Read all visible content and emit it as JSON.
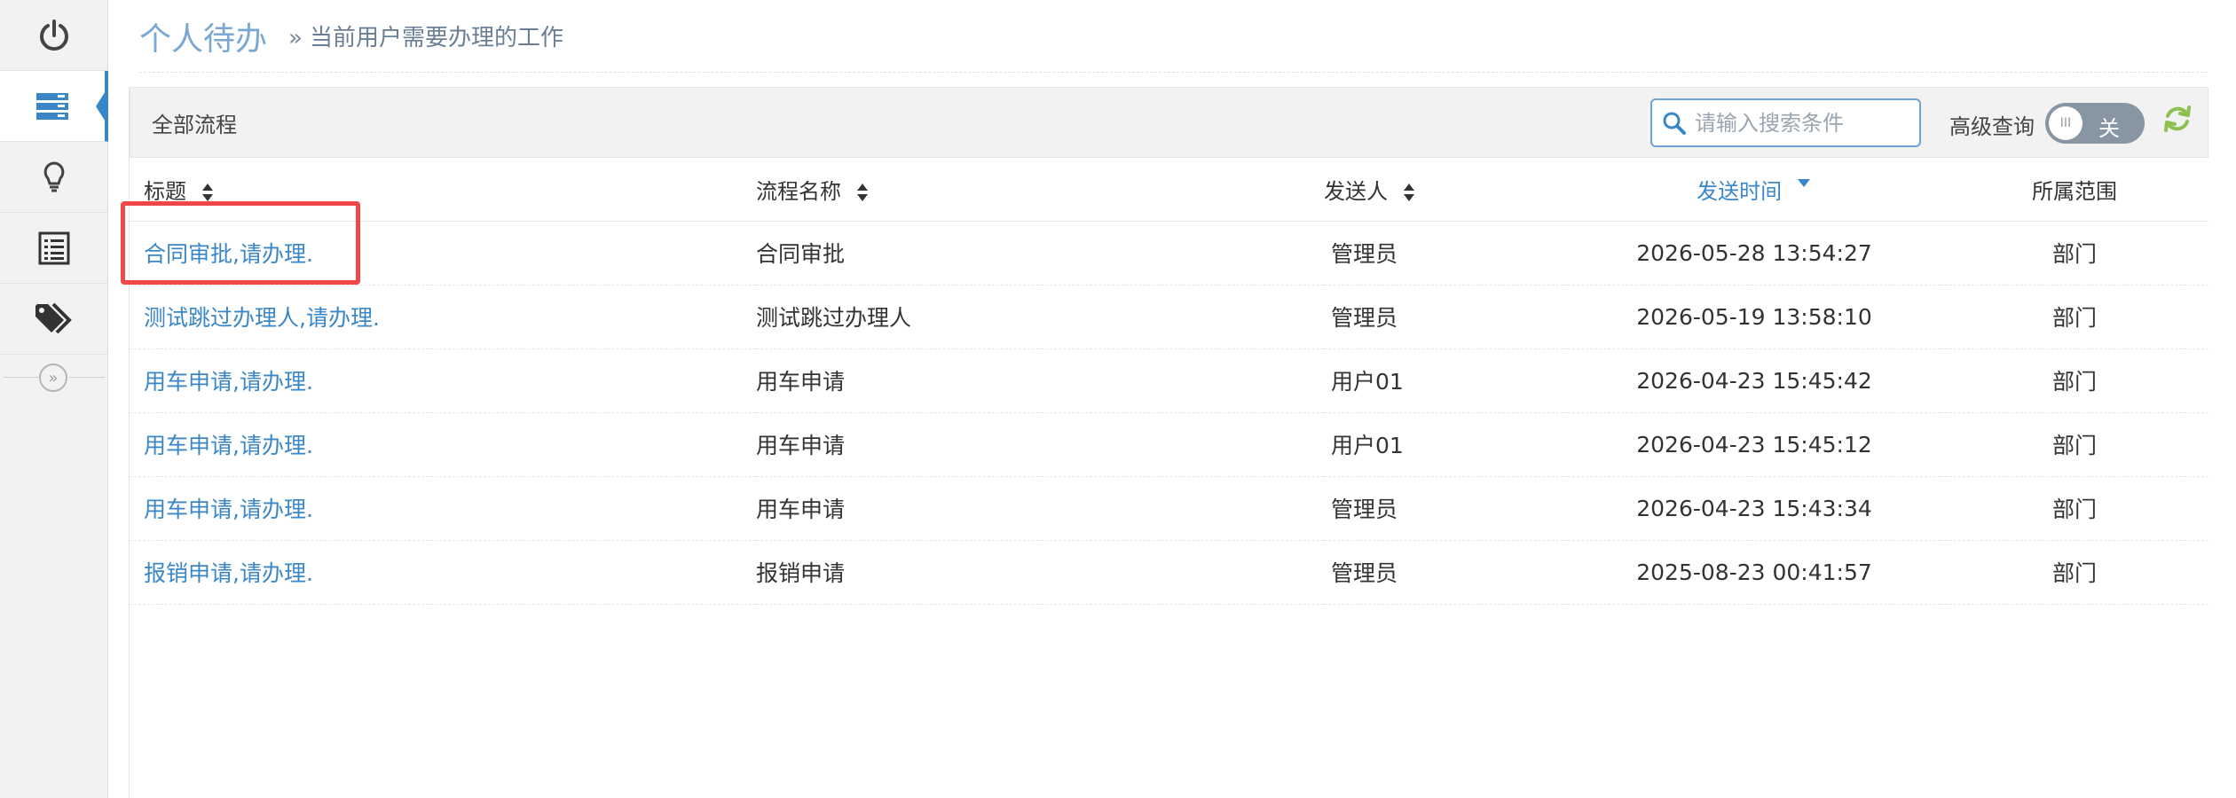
{
  "header": {
    "title": "个人待办",
    "subtitle_chevron": "»",
    "subtitle": "当前用户需要办理的工作"
  },
  "sidebar": {
    "items": [
      {
        "icon": "power-icon"
      },
      {
        "icon": "list-icon",
        "active": true
      },
      {
        "icon": "lightbulb-icon"
      },
      {
        "icon": "document-list-icon"
      },
      {
        "icon": "tags-icon"
      }
    ],
    "collapse_glyph": "»"
  },
  "toolbar": {
    "label": "全部流程",
    "search_placeholder": "请输入搜索条件",
    "advanced_label": "高级查询",
    "toggle_knob": "III",
    "toggle_state": "关"
  },
  "table": {
    "columns": [
      "标题",
      "流程名称",
      "发送人",
      "发送时间",
      "所属范围"
    ],
    "sorted_column": "发送时间",
    "rows": [
      {
        "title": "合同审批,请办理.",
        "flow": "合同审批",
        "sender": "管理员",
        "time": "2026-05-28 13:54:27",
        "scope": "部门"
      },
      {
        "title": "测试跳过办理人,请办理.",
        "flow": "测试跳过办理人",
        "sender": "管理员",
        "time": "2026-05-19 13:58:10",
        "scope": "部门"
      },
      {
        "title": "用车申请,请办理.",
        "flow": "用车申请",
        "sender": "用户01",
        "time": "2026-04-23 15:45:42",
        "scope": "部门"
      },
      {
        "title": "用车申请,请办理.",
        "flow": "用车申请",
        "sender": "用户01",
        "time": "2026-04-23 15:45:12",
        "scope": "部门"
      },
      {
        "title": "用车申请,请办理.",
        "flow": "用车申请",
        "sender": "管理员",
        "time": "2026-04-23 15:43:34",
        "scope": "部门"
      },
      {
        "title": "报销申请,请办理.",
        "flow": "报销申请",
        "sender": "管理员",
        "time": "2025-08-23 00:41:57",
        "scope": "部门"
      }
    ]
  },
  "colors": {
    "accent": "#3a87c8",
    "highlight": "#f04848",
    "refresh": "#8cc152"
  }
}
